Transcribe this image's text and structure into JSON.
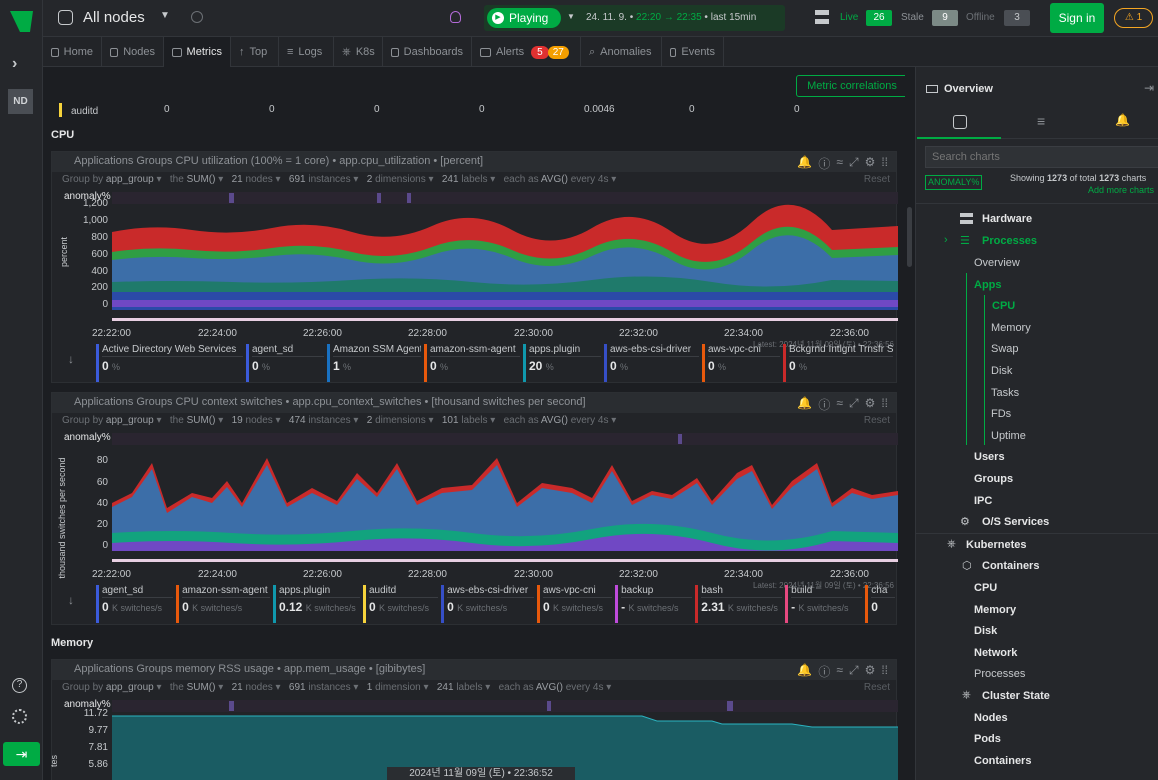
{
  "app": {
    "space_title": "All nodes",
    "playing_label": "Playing",
    "time_range": {
      "date": "24. 11. 9.",
      "from": "22:20",
      "to": "22:35",
      "last": "last",
      "duration": "15min"
    },
    "nodes": {
      "live_label": "Live",
      "live": "26",
      "stale_label": "Stale",
      "stale": "9",
      "offline_label": "Offline",
      "offline": "3"
    },
    "sign_in": "Sign in",
    "alert_count": "1",
    "rail_initials": "ND"
  },
  "tabs": [
    {
      "label": "Home",
      "icon": "home-icon"
    },
    {
      "label": "Nodes",
      "icon": "nodes-icon"
    },
    {
      "label": "Metrics",
      "icon": "metrics-icon"
    },
    {
      "label": "Top",
      "icon": "top-icon"
    },
    {
      "label": "Logs",
      "icon": "logs-icon"
    },
    {
      "label": "K8s",
      "icon": "k8s-icon"
    },
    {
      "label": "Dashboards",
      "icon": "dashboards-icon"
    },
    {
      "label": "Alerts",
      "icon": "alerts-icon",
      "badge_red": "5",
      "badge_orange": "27"
    },
    {
      "label": "Anomalies",
      "icon": "anomalies-icon"
    },
    {
      "label": "Events",
      "icon": "events-icon"
    }
  ],
  "main": {
    "metric_correlations": "Metric correlations",
    "auditd_row": {
      "name": "auditd",
      "values": [
        "0",
        "0",
        "0",
        "0",
        "0.0046",
        "0",
        "0"
      ]
    },
    "section_cpu": "CPU",
    "section_memory": "Memory",
    "charts": [
      {
        "title": "Applications Groups CPU utilization (100% = 1 core) • app.cpu_utilization • [percent]",
        "controls": {
          "group_by": "Group by",
          "group_val": "app_group",
          "the": "the",
          "agg": "SUM()",
          "nodes_n": "21",
          "nodes_l": "nodes",
          "inst_n": "691",
          "inst_l": "instances",
          "dim_n": "2",
          "dim_l": "dimensions",
          "labels_n": "241",
          "labels_l": "labels",
          "each": "each as",
          "avg": "AVG()",
          "every": "every 4s",
          "reset": "Reset"
        },
        "anomaly_label": "anomaly%",
        "ylabel": "percent",
        "yticks": [
          "1,200",
          "1,000",
          "800",
          "600",
          "400",
          "200",
          "0"
        ],
        "xticks": [
          "22:22:00",
          "22:24:00",
          "22:26:00",
          "22:28:00",
          "22:30:00",
          "22:32:00",
          "22:34:00",
          "22:36:00"
        ],
        "latest": "Latest: 2024년 11월 09일 (토) • 22:36:56",
        "legend": [
          {
            "name": "Active Directory Web Services",
            "value": "0",
            "unit": "%",
            "color": "#3b5bdb"
          },
          {
            "name": "agent_sd",
            "value": "0",
            "unit": "%",
            "color": "#3b5bdb"
          },
          {
            "name": "Amazon SSM Agent",
            "value": "1",
            "unit": "%",
            "color": "#1971c2"
          },
          {
            "name": "amazon-ssm-agent",
            "value": "0",
            "unit": "%",
            "color": "#e8590c"
          },
          {
            "name": "apps.plugin",
            "value": "20",
            "unit": "%",
            "color": "#1098ad"
          },
          {
            "name": "aws-ebs-csi-driver",
            "value": "0",
            "unit": "%",
            "color": "#364fc7"
          },
          {
            "name": "aws-vpc-cni",
            "value": "0",
            "unit": "%",
            "color": "#e8590c"
          },
          {
            "name": "Bckgrnd Intlgnt Trnsfr S",
            "value": "0",
            "unit": "%",
            "color": "#c92a2a"
          }
        ]
      },
      {
        "title": "Applications Groups CPU context switches • app.cpu_context_switches • [thousand switches per second]",
        "controls": {
          "group_by": "Group by",
          "group_val": "app_group",
          "the": "the",
          "agg": "SUM()",
          "nodes_n": "19",
          "nodes_l": "nodes",
          "inst_n": "474",
          "inst_l": "instances",
          "dim_n": "2",
          "dim_l": "dimensions",
          "labels_n": "101",
          "labels_l": "labels",
          "each": "each as",
          "avg": "AVG()",
          "every": "every 4s",
          "reset": "Reset"
        },
        "anomaly_label": "anomaly%",
        "ylabel": "thousand switches per second",
        "yticks": [
          "80",
          "60",
          "40",
          "20",
          "0"
        ],
        "xticks": [
          "22:22:00",
          "22:24:00",
          "22:26:00",
          "22:28:00",
          "22:30:00",
          "22:32:00",
          "22:34:00",
          "22:36:00"
        ],
        "latest": "Latest: 2024년 11월 09일 (토) • 22:36:56",
        "legend": [
          {
            "name": "agent_sd",
            "value": "0",
            "unit": "K switches/s",
            "color": "#3b5bdb"
          },
          {
            "name": "amazon-ssm-agent",
            "value": "0",
            "unit": "K switches/s",
            "color": "#e8590c"
          },
          {
            "name": "apps.plugin",
            "value": "0.12",
            "unit": "K switches/s",
            "color": "#1098ad"
          },
          {
            "name": "auditd",
            "value": "0",
            "unit": "K switches/s",
            "color": "#f6d33c"
          },
          {
            "name": "aws-ebs-csi-driver",
            "value": "0",
            "unit": "K switches/s",
            "color": "#364fc7"
          },
          {
            "name": "aws-vpc-cni",
            "value": "0",
            "unit": "K switches/s",
            "color": "#e8590c"
          },
          {
            "name": "backup",
            "value": "-",
            "unit": "K switches/s",
            "color": "#be4bdb"
          },
          {
            "name": "bash",
            "value": "2.31",
            "unit": "K switches/s",
            "color": "#c92a2a"
          },
          {
            "name": "build",
            "value": "-",
            "unit": "K switches/s",
            "color": "#e64980"
          },
          {
            "name": "cha",
            "value": "0",
            "unit": "",
            "color": "#e8590c"
          }
        ]
      },
      {
        "title": "Applications Groups memory RSS usage • app.mem_usage • [gibibytes]",
        "controls": {
          "group_by": "Group by",
          "group_val": "app_group",
          "the": "the",
          "agg": "SUM()",
          "nodes_n": "21",
          "nodes_l": "nodes",
          "inst_n": "691",
          "inst_l": "instances",
          "dim_n": "1",
          "dim_l": "dimension",
          "labels_n": "241",
          "labels_l": "labels",
          "each": "each as",
          "avg": "AVG()",
          "every": "every 4s",
          "reset": "Reset"
        },
        "anomaly_label": "anomaly%",
        "ylabel": "tes",
        "yticks": [
          "11.72",
          "9.77",
          "7.81",
          "5.86"
        ]
      }
    ],
    "hover_time": "2024년 11월 09일 (토) • 22:36:52"
  },
  "sidebar": {
    "title": "Overview",
    "search_placeholder": "Search charts",
    "anomaly_btn": "ANOMALY%",
    "showing": {
      "pre": "Showing",
      "shown": "1273",
      "mid": "of total",
      "total": "1273",
      "post": "charts"
    },
    "add_more": "Add more charts",
    "tree": [
      {
        "label": "Hardware",
        "level": 1,
        "bold": true
      },
      {
        "label": "Processes",
        "level": 1,
        "bold": true,
        "green": true
      },
      {
        "label": "Overview",
        "level": 2
      },
      {
        "label": "Apps",
        "level": 2,
        "bold": true,
        "green": true
      },
      {
        "label": "CPU",
        "level": 3,
        "bold": true,
        "green": true
      },
      {
        "label": "Memory",
        "level": 3
      },
      {
        "label": "Swap",
        "level": 3
      },
      {
        "label": "Disk",
        "level": 3
      },
      {
        "label": "Tasks",
        "level": 3
      },
      {
        "label": "FDs",
        "level": 3
      },
      {
        "label": "Uptime",
        "level": 3
      },
      {
        "label": "Users",
        "level": 2,
        "bold": true
      },
      {
        "label": "Groups",
        "level": 2,
        "bold": true
      },
      {
        "label": "IPC",
        "level": 2,
        "bold": true
      },
      {
        "label": "O/S Services",
        "level": 1,
        "bold": true
      },
      {
        "label": "Kubernetes",
        "level": 0,
        "bold": true
      },
      {
        "label": "Containers",
        "level": 1,
        "bold": true
      },
      {
        "label": "CPU",
        "level": 2,
        "bold": true
      },
      {
        "label": "Memory",
        "level": 2,
        "bold": true
      },
      {
        "label": "Disk",
        "level": 2,
        "bold": true
      },
      {
        "label": "Network",
        "level": 2,
        "bold": true
      },
      {
        "label": "Processes",
        "level": 2
      },
      {
        "label": "Cluster State",
        "level": 1,
        "bold": true
      },
      {
        "label": "Nodes",
        "level": 2,
        "bold": true
      },
      {
        "label": "Pods",
        "level": 2,
        "bold": true
      },
      {
        "label": "Containers",
        "level": 2,
        "bold": true
      }
    ]
  },
  "colors": {
    "accent": "#00ab44",
    "bg": "#1c1e22",
    "panel": "#25272b"
  }
}
